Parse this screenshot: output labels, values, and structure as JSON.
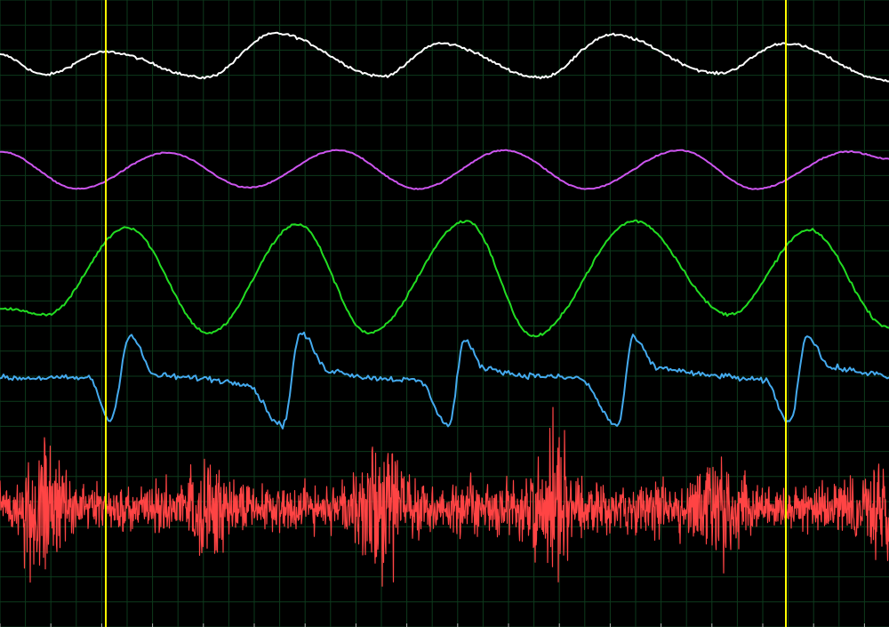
{
  "chart_data": {
    "type": "line",
    "title": "",
    "xlabel": "",
    "ylabel": "",
    "grid": true,
    "background_color": "#000000",
    "grid_color": "#0d3a1c",
    "cursor_color": "#ffff00",
    "x_range": [
      0,
      1000
    ],
    "cursors": [
      {
        "x": 119
      },
      {
        "x": 884
      }
    ],
    "series": [
      {
        "color": "#ffffff",
        "y_range": [
          -1,
          1
        ],
        "noise": 0.04,
        "x": [
          0,
          50,
          119,
          230,
          310,
          430,
          495,
          608,
          688,
          808,
          882,
          1000
        ],
        "y": [
          0.2,
          -0.5,
          0.3,
          -0.6,
          0.95,
          -0.55,
          0.6,
          -0.6,
          0.9,
          -0.45,
          0.6,
          -0.7
        ]
      },
      {
        "color": "#cc55ee",
        "y_range": [
          -1,
          1
        ],
        "noise": 0.02,
        "x": [
          0,
          88,
          188,
          280,
          380,
          470,
          568,
          660,
          765,
          850,
          955,
          1000
        ],
        "y": [
          0.7,
          -0.8,
          0.65,
          -0.75,
          0.75,
          -0.8,
          0.75,
          -0.8,
          0.75,
          -0.8,
          0.7,
          0.4
        ]
      },
      {
        "color": "#22dd22",
        "y_range": [
          -1,
          1
        ],
        "noise": 0.02,
        "x": [
          0,
          52,
          143,
          235,
          335,
          415,
          525,
          600,
          714,
          820,
          910,
          1000
        ],
        "y": [
          -0.55,
          -0.65,
          0.75,
          -0.95,
          0.8,
          -0.95,
          0.85,
          -1.0,
          0.85,
          -0.65,
          0.7,
          -0.85
        ]
      },
      {
        "color": "#44aaee",
        "y_range": [
          -1,
          1
        ],
        "noise": 0.05,
        "x": [
          0,
          100,
          124,
          146,
          175,
          220,
          275,
          318,
          338,
          370,
          420,
          470,
          505,
          522,
          545,
          590,
          650,
          695,
          712,
          740,
          800,
          860,
          888,
          908,
          935,
          980,
          1000
        ],
        "y": [
          0.0,
          0.0,
          -0.85,
          0.85,
          0.05,
          0.0,
          -0.1,
          -0.95,
          0.9,
          0.15,
          0.0,
          -0.05,
          -0.95,
          0.75,
          0.2,
          0.05,
          0.0,
          -0.95,
          0.8,
          0.2,
          0.05,
          -0.05,
          -0.9,
          0.85,
          0.2,
          0.1,
          0.0
        ]
      },
      {
        "color": "#ff4444",
        "y_range": [
          -1,
          1
        ],
        "noise": 0.0,
        "bursts": [
          {
            "x": 48,
            "amp": 0.85
          },
          {
            "x": 232,
            "amp": 0.7
          },
          {
            "x": 430,
            "amp": 1.0
          },
          {
            "x": 620,
            "amp": 0.85
          },
          {
            "x": 810,
            "amp": 0.8
          },
          {
            "x": 995,
            "amp": 0.7
          }
        ],
        "base_amp": 0.3
      }
    ]
  }
}
